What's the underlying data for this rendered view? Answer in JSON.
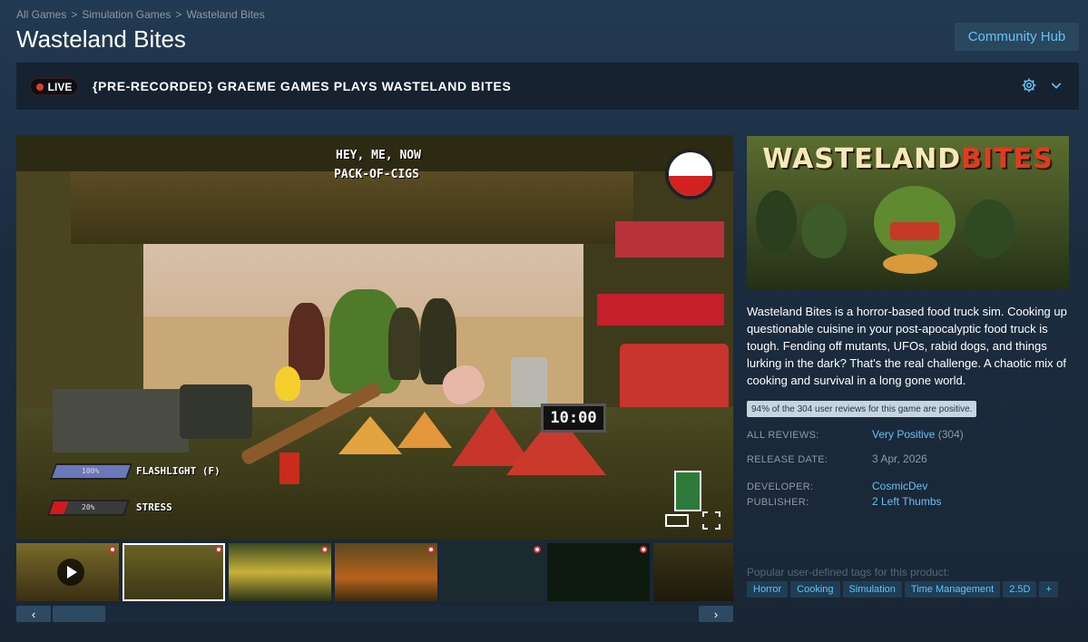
{
  "breadcrumb": [
    "All Games",
    "Simulation Games",
    "Wasteland Bites"
  ],
  "page_title": "Wasteland Bites",
  "community_hub_label": "Community Hub",
  "broadcast": {
    "live_label": "LIVE",
    "title": "{PRE-RECORDED} GRAEME GAMES PLAYS WASTELAND BITES"
  },
  "game_hud": {
    "order_line1": "HEY, ME, NOW",
    "order_line2": "PACK-OF-CIGS",
    "timer": "10:00",
    "flashlight_label": "FLASHLIGHT (F)",
    "flashlight_value": "100%",
    "stress_label": "STRESS",
    "stress_value": "20%"
  },
  "capsule": {
    "logo_part1": "WASTELAND",
    "logo_part2": "BITES"
  },
  "description": "Wasteland Bites is a horror-based food truck sim. Cooking up questionable cuisine in your post-apocalyptic food truck is tough. Fending off mutants, UFOs, rabid dogs, and things lurking in the dark? That's the real challenge. A chaotic mix of cooking and survival in a long gone world.",
  "review_tooltip": "94% of the 304 user reviews for this game are positive.",
  "info": {
    "all_reviews_label": "ALL REVIEWS:",
    "all_reviews_value": "Very Positive",
    "all_reviews_count": "(304)",
    "release_label": "RELEASE DATE:",
    "release_value": "3 Apr, 2026",
    "developer_label": "DEVELOPER:",
    "developer_value": "CosmicDev",
    "publisher_label": "PUBLISHER:",
    "publisher_value": "2 Left Thumbs"
  },
  "tags_label": "Popular user-defined tags for this product:",
  "tags": [
    "Horror",
    "Cooking",
    "Simulation",
    "Time Management",
    "2.5D",
    "+"
  ],
  "scroll": {
    "left": "‹",
    "right": "›"
  }
}
